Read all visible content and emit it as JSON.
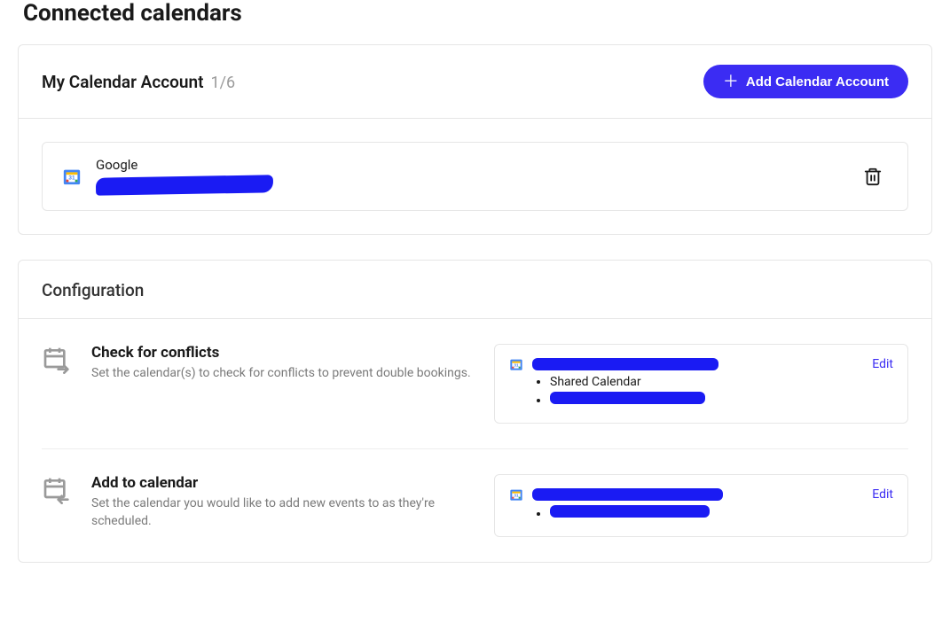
{
  "page": {
    "title": "Connected calendars"
  },
  "account_card": {
    "title": "My Calendar Account",
    "count": "1/6",
    "add_button": "Add Calendar Account",
    "account": {
      "provider": "Google",
      "email_redacted": true
    }
  },
  "config_card": {
    "title": "Configuration",
    "conflicts": {
      "title": "Check for conflicts",
      "description": "Set the calendar(s) to check for conflicts to prevent double bookings.",
      "edit_label": "Edit",
      "items": [
        {
          "redacted": true
        },
        {
          "label": "Shared Calendar",
          "redacted": false
        },
        {
          "redacted": true
        }
      ]
    },
    "add_to": {
      "title": "Add to calendar",
      "description": "Set the calendar you would like to add new events to as they're scheduled.",
      "edit_label": "Edit",
      "items": [
        {
          "redacted": true
        }
      ]
    }
  }
}
